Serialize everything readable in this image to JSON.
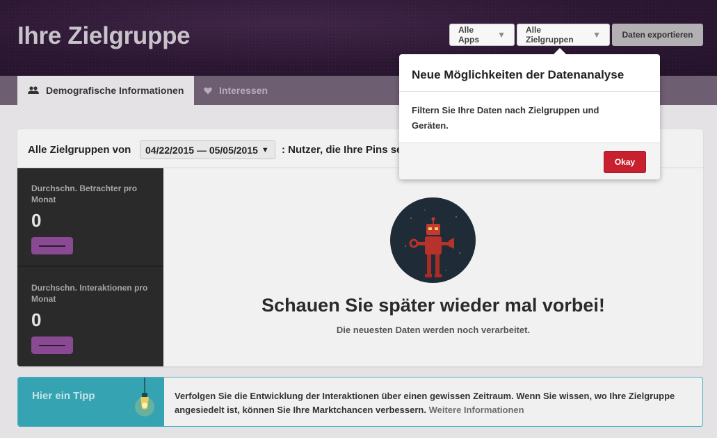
{
  "header": {
    "title": "Ihre Zielgruppe",
    "filters": {
      "apps_label": "Alle Apps",
      "groups_label": "Alle Zielgruppen",
      "export_label": "Daten exportieren"
    }
  },
  "tabs": [
    {
      "label": "Demografische Informationen",
      "icon": "users-icon",
      "active": true
    },
    {
      "label": "Interessen",
      "icon": "heart-icon",
      "active": false
    }
  ],
  "summary": {
    "prefix": "Alle Zielgruppen von",
    "date_range": "04/22/2015 — 05/05/2015",
    "suffix": ": Nutzer, die Ihre Pins se"
  },
  "metrics": [
    {
      "label": "Durchschn. Betrachter pro Monat",
      "value": "0"
    },
    {
      "label": "Durchschn. Interaktionen pro Monat",
      "value": "0"
    }
  ],
  "empty_state": {
    "title": "Schauen Sie später wieder mal vorbei!",
    "subtitle": "Die neuesten Daten werden noch verarbeitet."
  },
  "tip": {
    "title": "Hier ein Tipp",
    "text": "Verfolgen Sie die Entwicklung der Interaktionen über einen gewissen Zeitraum. Wenn Sie wissen, wo Ihre Zielgruppe angesiedelt ist, können Sie Ihre Marktchancen verbessern.",
    "link": "Weitere Informationen"
  },
  "popover": {
    "title": "Neue Möglichkeiten der Datenanalyse",
    "body": "Filtern Sie Ihre Daten nach Zielgruppen und Geräten.",
    "okay_label": "Okay"
  },
  "colors": {
    "header_bg": "#2c1733",
    "tabbar_bg": "#6e5e72",
    "accent_red": "#c8202f",
    "tip_teal": "#35a3b2",
    "metric_pill": "#8a4a93"
  }
}
